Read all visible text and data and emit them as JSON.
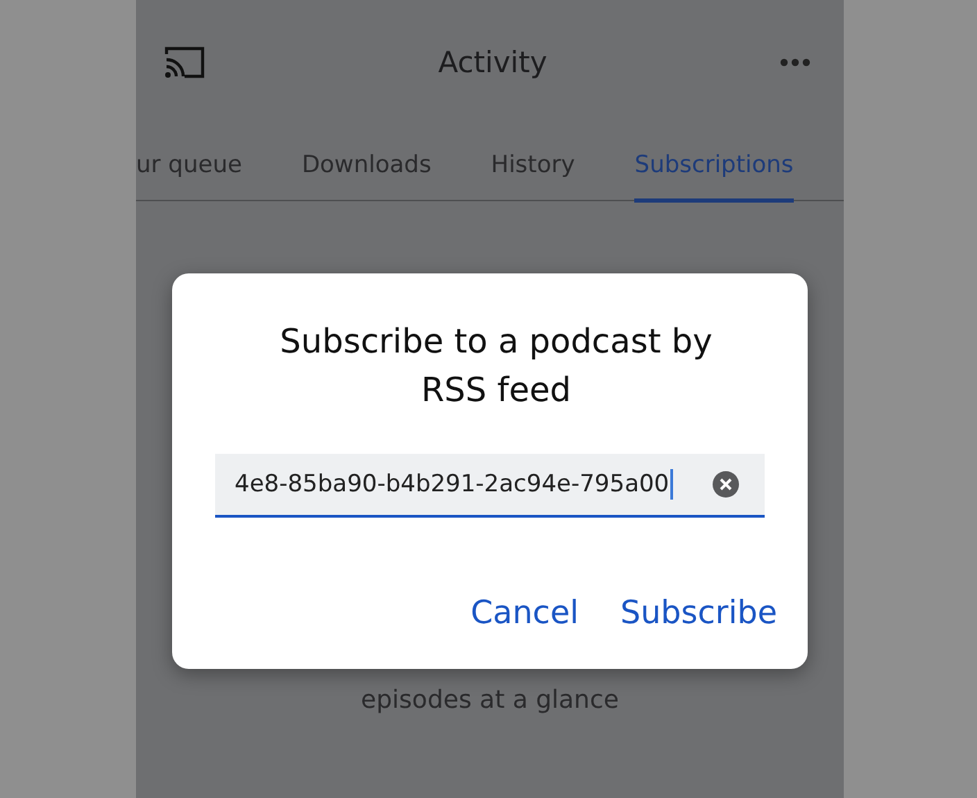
{
  "app_bar": {
    "title": "Activity"
  },
  "tabs": [
    {
      "label": "ur queue",
      "selected": false
    },
    {
      "label": "Downloads",
      "selected": false
    },
    {
      "label": "History",
      "selected": false
    },
    {
      "label": "Subscriptions",
      "selected": true
    }
  ],
  "empty_state": {
    "text": "episodes at a glance"
  },
  "dialog": {
    "title": "Subscribe to a podcast by RSS feed",
    "field": {
      "value": "4e8-85ba90-b4b291-2ac94e-795a00"
    },
    "buttons": [
      "Cancel",
      "Subscribe"
    ]
  }
}
